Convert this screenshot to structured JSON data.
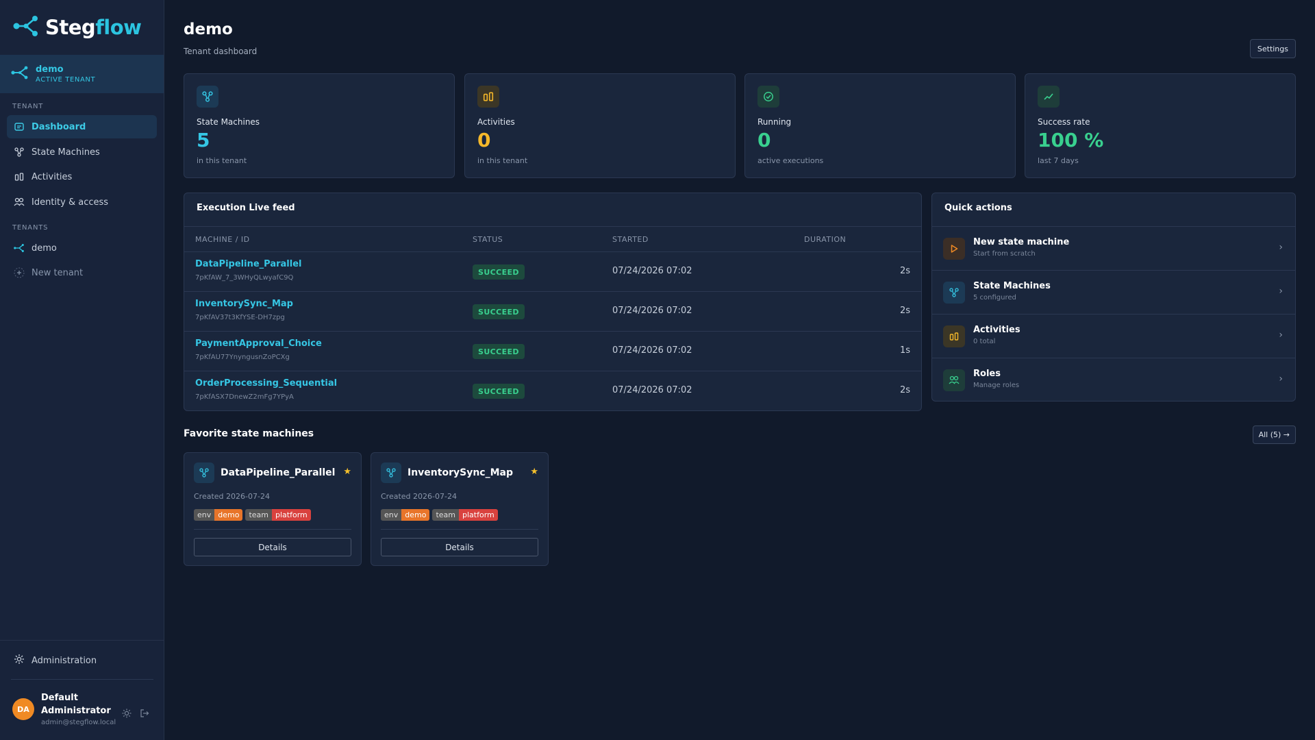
{
  "brand": {
    "name_part1": "Steg",
    "name_part2": "flow"
  },
  "active_tenant": {
    "name": "demo",
    "label": "ACTIVE TENANT"
  },
  "sidebar": {
    "tenant_section": "TENANT",
    "items": [
      {
        "label": "Dashboard",
        "icon": "dashboard-icon",
        "active": true
      },
      {
        "label": "State Machines",
        "icon": "state-machine-icon"
      },
      {
        "label": "Activities",
        "icon": "activities-icon"
      },
      {
        "label": "Identity & access",
        "icon": "users-icon"
      }
    ],
    "tenants_section": "TENANTS",
    "tenants": [
      {
        "label": "demo"
      }
    ],
    "new_tenant": "New tenant",
    "administration": "Administration"
  },
  "user": {
    "initials": "DA",
    "name_line1": "Default",
    "name_line2": "Administrator",
    "email": "admin@stegflow.local"
  },
  "header": {
    "title": "demo",
    "subtitle": "Tenant dashboard",
    "settings": "Settings"
  },
  "stats": [
    {
      "label": "State Machines",
      "value": "5",
      "sub": "in this tenant",
      "color": "#35c6e4",
      "icon": "state-machine-icon"
    },
    {
      "label": "Activities",
      "value": "0",
      "sub": "in this tenant",
      "color": "#f5b82a",
      "icon": "activities-icon"
    },
    {
      "label": "Running",
      "value": "0",
      "sub": "active executions",
      "color": "#39d08f",
      "icon": "check-circle-icon"
    },
    {
      "label": "Success rate",
      "value": "100 %",
      "sub": "last 7 days",
      "color": "#39d08f",
      "icon": "trend-up-icon"
    }
  ],
  "feed": {
    "title": "Execution Live feed",
    "columns": [
      "MACHINE / ID",
      "STATUS",
      "STARTED",
      "DURATION"
    ],
    "rows": [
      {
        "name": "DataPipeline_Parallel",
        "id": "7pKfAW_7_3WHyQLwyafC9Q",
        "status": "SUCCEED",
        "started": "07/24/2026 07:02",
        "duration": "2s"
      },
      {
        "name": "InventorySync_Map",
        "id": "7pKfAV37t3KfYSE-DH7zpg",
        "status": "SUCCEED",
        "started": "07/24/2026 07:02",
        "duration": "2s"
      },
      {
        "name": "PaymentApproval_Choice",
        "id": "7pKfAU77YnyngusnZoPCXg",
        "status": "SUCCEED",
        "started": "07/24/2026 07:02",
        "duration": "1s"
      },
      {
        "name": "OrderProcessing_Sequential",
        "id": "7pKfASX7DnewZ2mFg7YPyA",
        "status": "SUCCEED",
        "started": "07/24/2026 07:02",
        "duration": "2s"
      }
    ]
  },
  "quick_actions": {
    "title": "Quick actions",
    "items": [
      {
        "title": "New state machine",
        "sub": "Start from scratch",
        "icon": "play-icon",
        "color": "#f08a24"
      },
      {
        "title": "State Machines",
        "sub": "5 configured",
        "icon": "state-machine-icon",
        "color": "#35c6e4"
      },
      {
        "title": "Activities",
        "sub": "0 total",
        "icon": "activities-icon",
        "color": "#f5b82a"
      },
      {
        "title": "Roles",
        "sub": "Manage roles",
        "icon": "users-icon",
        "color": "#39d08f"
      }
    ]
  },
  "favorites": {
    "title": "Favorite state machines",
    "all_button": "All (5) →",
    "items": [
      {
        "name": "DataPipeline_Parallel",
        "created": "Created 2026-07-24",
        "tags": [
          {
            "key": "env",
            "value": "demo",
            "color": "#e8752a"
          },
          {
            "key": "team",
            "value": "platform",
            "color": "#d9423e"
          }
        ],
        "details": "Details"
      },
      {
        "name": "InventorySync_Map",
        "created": "Created 2026-07-24",
        "tags": [
          {
            "key": "env",
            "value": "demo",
            "color": "#e8752a"
          },
          {
            "key": "team",
            "value": "platform",
            "color": "#d9423e"
          }
        ],
        "details": "Details"
      }
    ]
  }
}
